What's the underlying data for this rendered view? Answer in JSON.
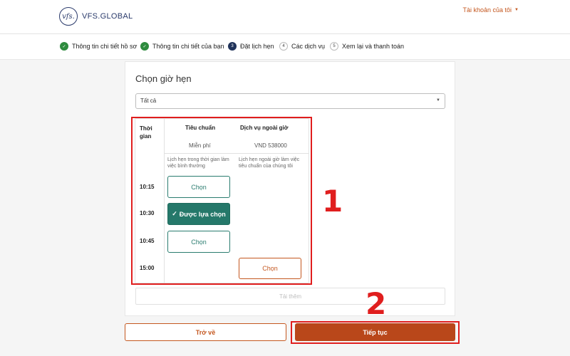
{
  "header": {
    "brand_mark": "vfs.",
    "brand_name": "VFS.GLOBAL",
    "account_label": "Tài khoản của tôi"
  },
  "steps": [
    {
      "label": "Thông tin chi tiết hồ sơ",
      "marker": "✓",
      "state": "done"
    },
    {
      "label": "Thông tin chi tiết của bạn",
      "marker": "✓",
      "state": "done"
    },
    {
      "label": "Đặt lịch hẹn",
      "marker": "3",
      "state": "active"
    },
    {
      "label": "Các dịch vụ",
      "marker": "4",
      "state": "pending"
    },
    {
      "label": "Xem lại và thanh toán",
      "marker": "5",
      "state": "pending"
    }
  ],
  "main": {
    "title": "Chọn giờ hẹn",
    "filter_value": "Tất cả"
  },
  "table": {
    "col_time": "Thời gian",
    "col_standard": "Tiêu chuẩn",
    "col_standard_price": "Miễn phí",
    "col_standard_note": "Lịch hẹn trong thời gian làm việc bình thường",
    "col_after": "Dịch vụ ngoài giờ",
    "col_after_price": "VND 538000",
    "col_after_note": "Lịch hẹn ngoài giờ làm việc tiêu chuẩn của chúng tôi",
    "slots": [
      {
        "time": "10:15",
        "standard": "Chọn",
        "after": ""
      },
      {
        "time": "10:30",
        "standard": "Được lựa chọn",
        "after": ""
      },
      {
        "time": "10:45",
        "standard": "Chọn",
        "after": ""
      },
      {
        "time": "15:00",
        "standard": "",
        "after": "Chọn"
      }
    ]
  },
  "load_more": "Tải thêm",
  "footer": {
    "back": "Trở về",
    "next": "Tiếp tục"
  },
  "annotations": [
    "1",
    "2"
  ],
  "colors": {
    "accent_orange": "#c4571f",
    "teal": "#25786a",
    "annotation_red": "#e01e1e"
  }
}
